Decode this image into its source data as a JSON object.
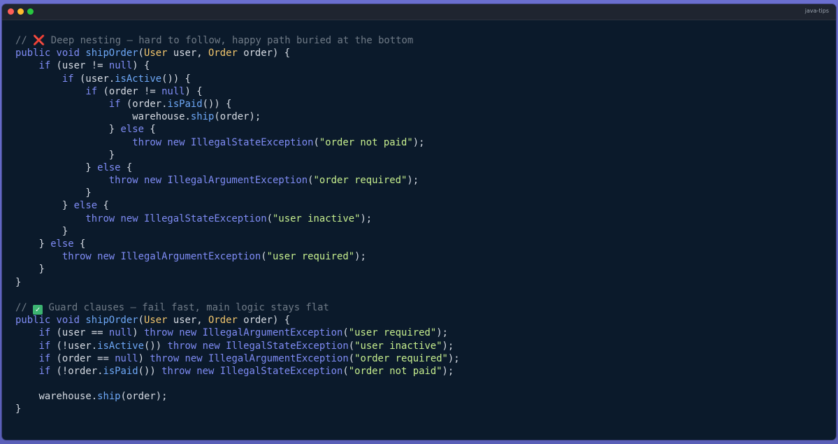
{
  "window": {
    "title": "java-tips",
    "colors": {
      "background": "#0b1a2b",
      "titlebar": "#1f2530",
      "close": "#ff5f57",
      "minimize": "#febc2e",
      "maximize": "#28c840"
    }
  },
  "code": {
    "lines": [
      [
        {
          "t": "// ",
          "c": "comment"
        },
        {
          "t": "❌",
          "c": "emoji-x"
        },
        {
          "t": " Deep nesting — hard to follow, happy path buried at the bottom",
          "c": "comment"
        }
      ],
      [
        {
          "t": "public void ",
          "c": "keyword"
        },
        {
          "t": "shipOrder",
          "c": "func"
        },
        {
          "t": "(",
          "c": "plain"
        },
        {
          "t": "User",
          "c": "type"
        },
        {
          "t": " user, ",
          "c": "plain"
        },
        {
          "t": "Order",
          "c": "type"
        },
        {
          "t": " order) {",
          "c": "plain"
        }
      ],
      [
        {
          "t": "    if ",
          "c": "keyword"
        },
        {
          "t": "(user != ",
          "c": "plain"
        },
        {
          "t": "null",
          "c": "keyword"
        },
        {
          "t": ") {",
          "c": "plain"
        }
      ],
      [
        {
          "t": "        if ",
          "c": "keyword"
        },
        {
          "t": "(user.",
          "c": "plain"
        },
        {
          "t": "isActive",
          "c": "func"
        },
        {
          "t": "()) {",
          "c": "plain"
        }
      ],
      [
        {
          "t": "            if ",
          "c": "keyword"
        },
        {
          "t": "(order != ",
          "c": "plain"
        },
        {
          "t": "null",
          "c": "keyword"
        },
        {
          "t": ") {",
          "c": "plain"
        }
      ],
      [
        {
          "t": "                if ",
          "c": "keyword"
        },
        {
          "t": "(order.",
          "c": "plain"
        },
        {
          "t": "isPaid",
          "c": "func"
        },
        {
          "t": "()) {",
          "c": "plain"
        }
      ],
      [
        {
          "t": "                    warehouse.",
          "c": "plain"
        },
        {
          "t": "ship",
          "c": "func"
        },
        {
          "t": "(order);",
          "c": "plain"
        }
      ],
      [
        {
          "t": "                } ",
          "c": "plain"
        },
        {
          "t": "else",
          "c": "keyword"
        },
        {
          "t": " {",
          "c": "plain"
        }
      ],
      [
        {
          "t": "                    throw new ",
          "c": "keyword"
        },
        {
          "t": "IllegalStateException",
          "c": "class"
        },
        {
          "t": "(",
          "c": "plain"
        },
        {
          "t": "\"order not paid\"",
          "c": "string"
        },
        {
          "t": ");",
          "c": "plain"
        }
      ],
      [
        {
          "t": "                }",
          "c": "plain"
        }
      ],
      [
        {
          "t": "            } ",
          "c": "plain"
        },
        {
          "t": "else",
          "c": "keyword"
        },
        {
          "t": " {",
          "c": "plain"
        }
      ],
      [
        {
          "t": "                throw new ",
          "c": "keyword"
        },
        {
          "t": "IllegalArgumentException",
          "c": "class"
        },
        {
          "t": "(",
          "c": "plain"
        },
        {
          "t": "\"order required\"",
          "c": "string"
        },
        {
          "t": ");",
          "c": "plain"
        }
      ],
      [
        {
          "t": "            }",
          "c": "plain"
        }
      ],
      [
        {
          "t": "        } ",
          "c": "plain"
        },
        {
          "t": "else",
          "c": "keyword"
        },
        {
          "t": " {",
          "c": "plain"
        }
      ],
      [
        {
          "t": "            throw new ",
          "c": "keyword"
        },
        {
          "t": "IllegalStateException",
          "c": "class"
        },
        {
          "t": "(",
          "c": "plain"
        },
        {
          "t": "\"user inactive\"",
          "c": "string"
        },
        {
          "t": ");",
          "c": "plain"
        }
      ],
      [
        {
          "t": "        }",
          "c": "plain"
        }
      ],
      [
        {
          "t": "    } ",
          "c": "plain"
        },
        {
          "t": "else",
          "c": "keyword"
        },
        {
          "t": " {",
          "c": "plain"
        }
      ],
      [
        {
          "t": "        throw new ",
          "c": "keyword"
        },
        {
          "t": "IllegalArgumentException",
          "c": "class"
        },
        {
          "t": "(",
          "c": "plain"
        },
        {
          "t": "\"user required\"",
          "c": "string"
        },
        {
          "t": ");",
          "c": "plain"
        }
      ],
      [
        {
          "t": "    }",
          "c": "plain"
        }
      ],
      [
        {
          "t": "}",
          "c": "plain"
        }
      ],
      [],
      [
        {
          "t": "// ",
          "c": "comment"
        },
        {
          "t": "✓",
          "c": "emoji-check"
        },
        {
          "t": " Guard clauses — fail fast, main logic stays flat",
          "c": "comment"
        }
      ],
      [
        {
          "t": "public void ",
          "c": "keyword"
        },
        {
          "t": "shipOrder",
          "c": "func"
        },
        {
          "t": "(",
          "c": "plain"
        },
        {
          "t": "User",
          "c": "type"
        },
        {
          "t": " user, ",
          "c": "plain"
        },
        {
          "t": "Order",
          "c": "type"
        },
        {
          "t": " order) {",
          "c": "plain"
        }
      ],
      [
        {
          "t": "    if ",
          "c": "keyword"
        },
        {
          "t": "(user == ",
          "c": "plain"
        },
        {
          "t": "null",
          "c": "keyword"
        },
        {
          "t": ") ",
          "c": "plain"
        },
        {
          "t": "throw new ",
          "c": "keyword"
        },
        {
          "t": "IllegalArgumentException",
          "c": "class"
        },
        {
          "t": "(",
          "c": "plain"
        },
        {
          "t": "\"user required\"",
          "c": "string"
        },
        {
          "t": ");",
          "c": "plain"
        }
      ],
      [
        {
          "t": "    if ",
          "c": "keyword"
        },
        {
          "t": "(!user.",
          "c": "plain"
        },
        {
          "t": "isActive",
          "c": "func"
        },
        {
          "t": "()) ",
          "c": "plain"
        },
        {
          "t": "throw new ",
          "c": "keyword"
        },
        {
          "t": "IllegalStateException",
          "c": "class"
        },
        {
          "t": "(",
          "c": "plain"
        },
        {
          "t": "\"user inactive\"",
          "c": "string"
        },
        {
          "t": ");",
          "c": "plain"
        }
      ],
      [
        {
          "t": "    if ",
          "c": "keyword"
        },
        {
          "t": "(order == ",
          "c": "plain"
        },
        {
          "t": "null",
          "c": "keyword"
        },
        {
          "t": ") ",
          "c": "plain"
        },
        {
          "t": "throw new ",
          "c": "keyword"
        },
        {
          "t": "IllegalArgumentException",
          "c": "class"
        },
        {
          "t": "(",
          "c": "plain"
        },
        {
          "t": "\"order required\"",
          "c": "string"
        },
        {
          "t": ");",
          "c": "plain"
        }
      ],
      [
        {
          "t": "    if ",
          "c": "keyword"
        },
        {
          "t": "(!order.",
          "c": "plain"
        },
        {
          "t": "isPaid",
          "c": "func"
        },
        {
          "t": "()) ",
          "c": "plain"
        },
        {
          "t": "throw new ",
          "c": "keyword"
        },
        {
          "t": "IllegalStateException",
          "c": "class"
        },
        {
          "t": "(",
          "c": "plain"
        },
        {
          "t": "\"order not paid\"",
          "c": "string"
        },
        {
          "t": ");",
          "c": "plain"
        }
      ],
      [],
      [
        {
          "t": "    warehouse.",
          "c": "plain"
        },
        {
          "t": "ship",
          "c": "func"
        },
        {
          "t": "(order);",
          "c": "plain"
        }
      ],
      [
        {
          "t": "}",
          "c": "plain"
        }
      ]
    ]
  }
}
